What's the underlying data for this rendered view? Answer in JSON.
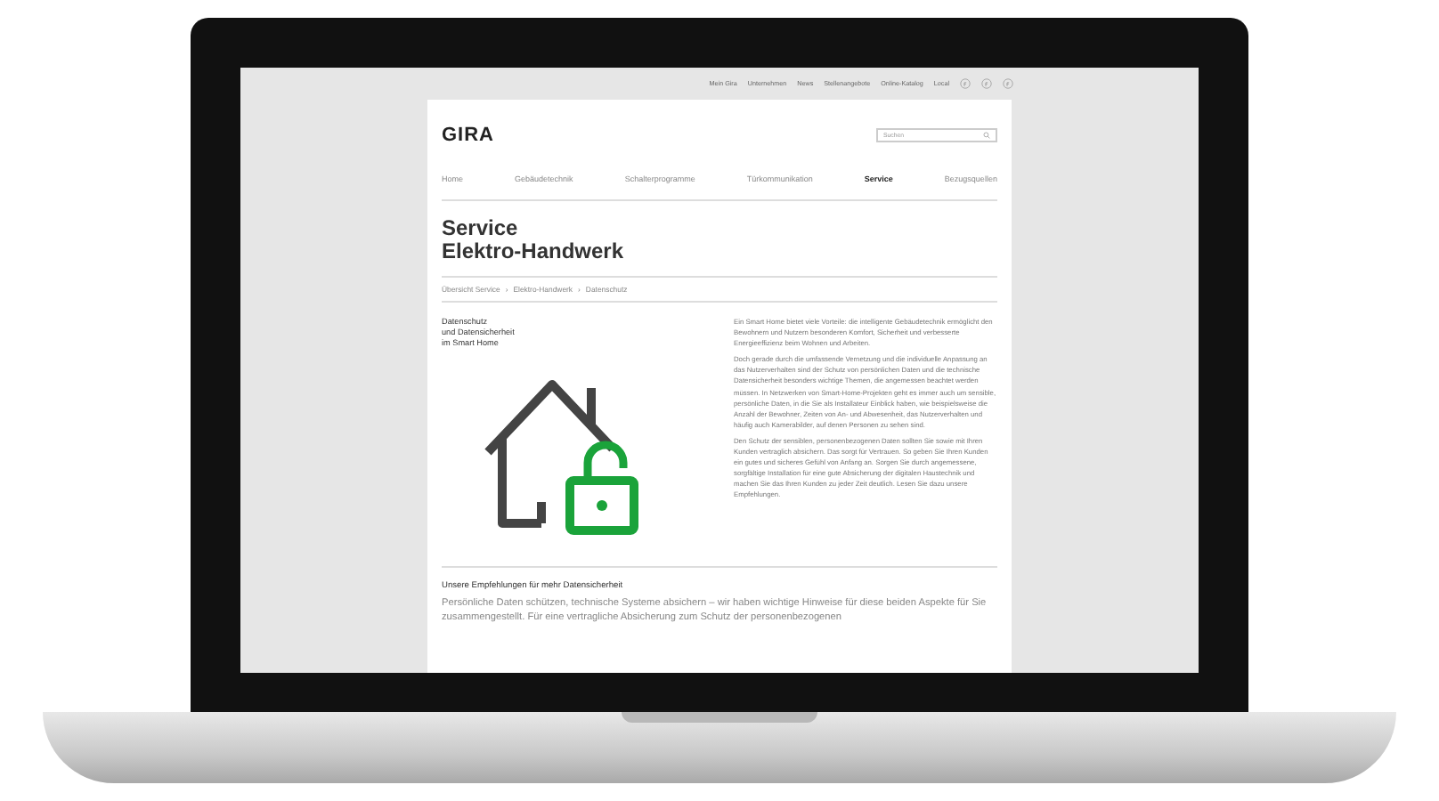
{
  "top_links": [
    "Mein Gira",
    "Unternehmen",
    "News",
    "Stellenangebote",
    "Online-Katalog",
    "Local"
  ],
  "logo": "GIRA",
  "search": {
    "placeholder": "Suchen"
  },
  "nav": [
    {
      "label": "Home",
      "selected": false
    },
    {
      "label": "Gebäudetechnik",
      "selected": false
    },
    {
      "label": "Schalterprogramme",
      "selected": false
    },
    {
      "label": "Türkommunikation",
      "selected": false
    },
    {
      "label": "Service",
      "selected": true
    },
    {
      "label": "Bezugsquellen",
      "selected": false
    }
  ],
  "heading": [
    "Service",
    "Elektro-Handwerk"
  ],
  "breadcrumb": [
    {
      "label": "Übersicht Service"
    },
    {
      "separator": "›",
      "label": "Elektro-Handwerk"
    },
    {
      "separator": "›",
      "label": "Datenschutz"
    }
  ],
  "intro_title": [
    "Datenschutz",
    "und Datensicherheit",
    "im Smart Home"
  ],
  "paragraphs": [
    "Ein Smart Home bietet viele Vorteile: die intelligente Gebäudetechnik ermöglicht den Bewohnern und Nutzern besonderen Komfort, Sicherheit und verbesserte Energieeffizienz beim Wohnen und Arbeiten.",
    "Doch gerade durch die umfassende Vernetzung und die individuelle Anpassung an das Nutzerverhalten sind der Schutz von persönlichen Daten und die technische Datensicherheit besonders wichtige Themen, die angemessen beachtet werden müssen. In Netzwerken von Smart-Home-Projekten geht es immer auch um sensible, persönliche Daten, in die Sie als Installateur Einblick haben, wie beispielsweise die Anzahl der Bewohner, Zeiten von An- und Abwesenheit, das Nutzerverhalten und häufig auch Kamerabilder, auf denen Personen zu sehen sind.",
    "Den Schutz der sensiblen, personenbezogenen Daten sollten Sie sowie mit Ihren Kunden vertraglich absichern. Das sorgt für Vertrauen. So geben Sie Ihren Kunden ein gutes und sicheres Gefühl von Anfang an. Sorgen Sie durch angemessene, sorgfältige Installation für eine gute Absicherung der digitalen Haustechnik und machen Sie das Ihren Kunden zu jeder Zeit deutlich. Lesen Sie dazu unsere Empfehlungen."
  ],
  "section": {
    "title": "Unsere Empfehlungen für mehr Datensicherheit",
    "text": "Persönliche Daten schützen, technische Systeme absichern – wir haben wichtige Hinweise für diese beiden Aspekte für Sie zusammengestellt. Für eine vertragliche Absicherung zum Schutz der personenbezogenen"
  }
}
